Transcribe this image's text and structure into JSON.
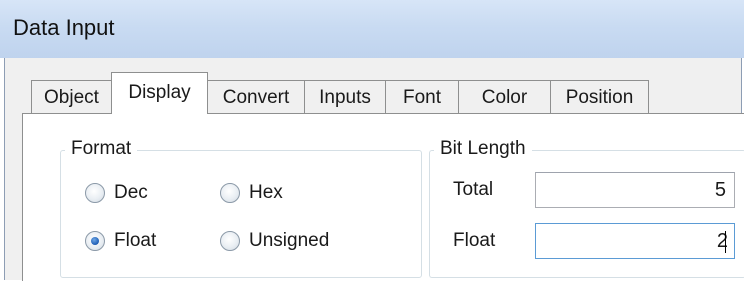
{
  "window": {
    "title": "Data Input"
  },
  "tabs": [
    {
      "label": "Object",
      "active": false
    },
    {
      "label": "Display",
      "active": true
    },
    {
      "label": "Convert",
      "active": false
    },
    {
      "label": "Inputs",
      "active": false
    },
    {
      "label": "Font",
      "active": false
    },
    {
      "label": "Color",
      "active": false
    },
    {
      "label": "Position",
      "active": false
    }
  ],
  "format_group": {
    "label": "Format",
    "options": [
      {
        "label": "Dec",
        "checked": false
      },
      {
        "label": "Hex",
        "checked": false
      },
      {
        "label": "Float",
        "checked": true
      },
      {
        "label": "Unsigned",
        "checked": false
      }
    ]
  },
  "bit_length_group": {
    "label": "Bit Length",
    "total": {
      "label": "Total",
      "value": "5"
    },
    "float": {
      "label": "Float",
      "value": "2"
    }
  }
}
